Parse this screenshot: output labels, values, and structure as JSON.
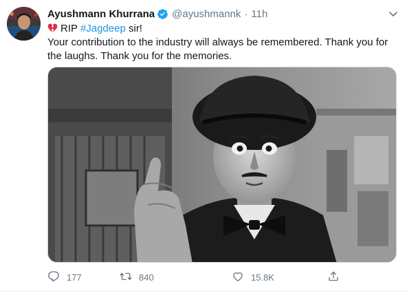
{
  "tweet": {
    "author": {
      "name": "Ayushmann Khurrana",
      "handle": "@ayushmannk",
      "time": "11h",
      "separator": "·"
    },
    "text": {
      "line1_prefix": "RIP",
      "hashtag": "#Jagdeep",
      "line1_suffix": "sir!",
      "line2": "Your contribution to the industry will always be remembered. Thank you for",
      "line3": "the laughs. Thank you for the memories."
    },
    "media": {
      "kind": "black-and-white photo",
      "icon": "photo-image"
    },
    "actions": {
      "reply_count": "177",
      "retweet_count": "840",
      "like_count": "15.8K"
    },
    "icons": {
      "verified": "verified-badge-icon",
      "broken_heart": "broken-heart-emoji",
      "reply": "reply-icon",
      "retweet": "retweet-icon",
      "like": "heart-icon",
      "share": "share-icon",
      "more": "chevron-down-icon"
    },
    "colors": {
      "accent": "#1b95e0",
      "verified": "#1da1f2",
      "secondary_text": "#657786",
      "emoji_red": "#dd2e44"
    }
  }
}
